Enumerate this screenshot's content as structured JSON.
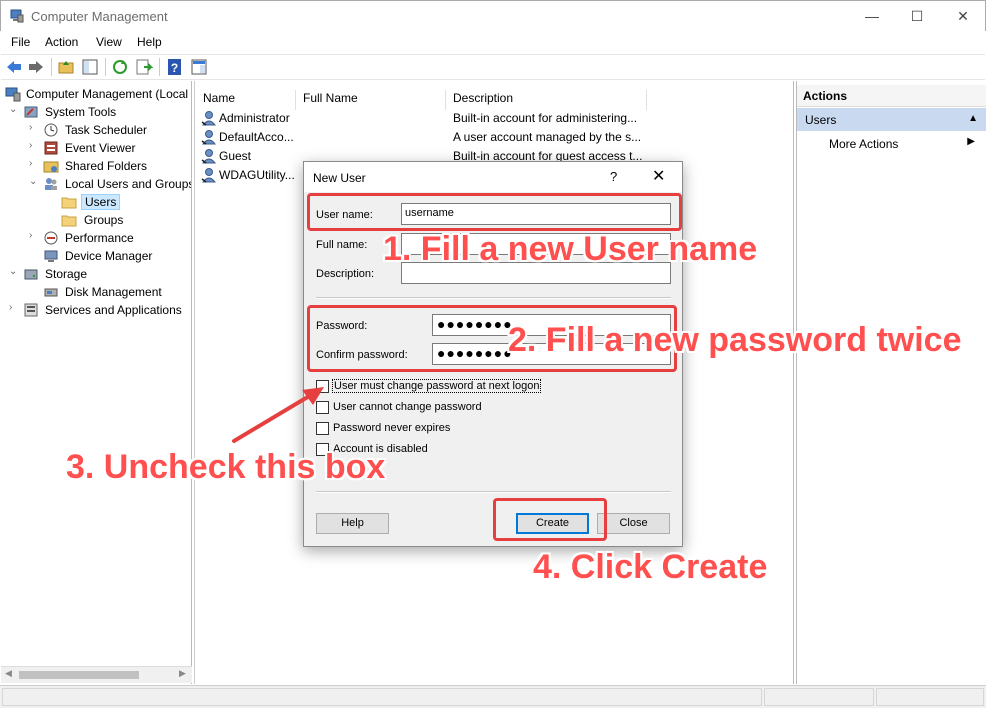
{
  "window": {
    "title": "Computer Management",
    "minimize": "—",
    "maximize": "☐",
    "close": "✕"
  },
  "menu": [
    "File",
    "Action",
    "View",
    "Help"
  ],
  "tree": {
    "root": "Computer Management (Local",
    "system_tools": "System Tools",
    "task_scheduler": "Task Scheduler",
    "event_viewer": "Event Viewer",
    "shared_folders": "Shared Folders",
    "local_users": "Local Users and Groups",
    "users": "Users",
    "groups": "Groups",
    "performance": "Performance",
    "device_manager": "Device Manager",
    "storage": "Storage",
    "disk_management": "Disk Management",
    "services": "Services and Applications"
  },
  "list": {
    "columns": [
      "Name",
      "Full Name",
      "Description"
    ],
    "rows": [
      {
        "name": "Administrator",
        "desc": "Built-in account for administering..."
      },
      {
        "name": "DefaultAcco...",
        "desc": "A user account managed by the s..."
      },
      {
        "name": "Guest",
        "desc": "Built-in account for guest access t..."
      },
      {
        "name": "WDAGUtility...",
        "desc": ""
      }
    ]
  },
  "actions": {
    "header": "Actions",
    "section": "Users",
    "more": "More Actions"
  },
  "dialog": {
    "title": "New User",
    "help_glyph": "?",
    "close_glyph": "✕",
    "username_label": "User name:",
    "username_value": "username",
    "fullname_label": "Full name:",
    "description_label": "Description:",
    "password_label": "Password:",
    "password_value": "●●●●●●●●",
    "confirm_label": "Confirm password:",
    "confirm_value": "●●●●●●●●",
    "chk_must_change": "User must change password at next logon",
    "chk_cannot_change": "User cannot change password",
    "chk_never_expires": "Password never expires",
    "chk_disabled": "Account is disabled",
    "help_button": "Help",
    "create_button": "Create",
    "close_button": "Close"
  },
  "annotations": {
    "step1": "1. Fill a new User name",
    "step2": "2. Fill a new password twice",
    "step3": "3. Uncheck this box",
    "step4": "4. Click Create",
    "color": "#e53f3f"
  }
}
